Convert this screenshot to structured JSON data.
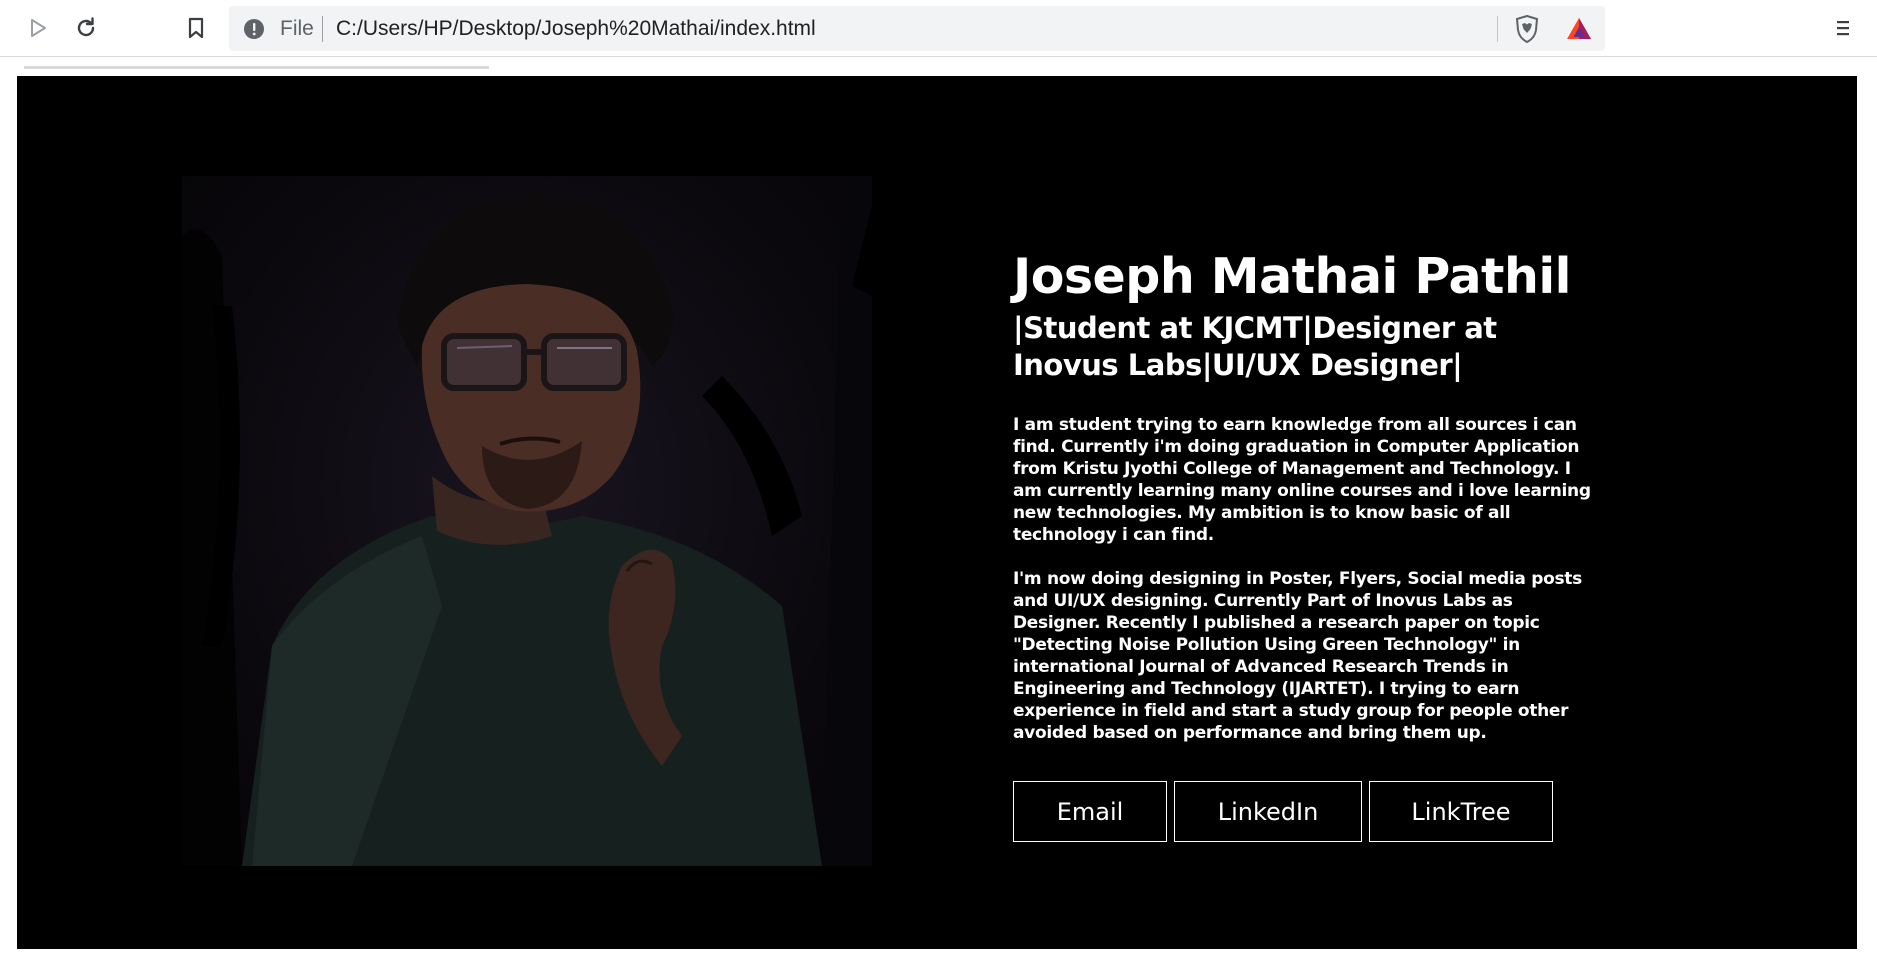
{
  "browser": {
    "url_scheme": "File",
    "url": "C:/Users/HP/Desktop/Joseph%20Mathai/index.html"
  },
  "profile": {
    "name": "Joseph Mathai Pathil",
    "tagline": "|Student at KJCMT|Designer at Inovus Labs|UI/UX Designer|",
    "paragraph_1": "I am student trying to earn knowledge from all sources i can find. Currently i'm doing graduation in Computer Application from Kristu Jyothi College of Management and Technology. I am currently learning many online courses and i love learning new technologies. My ambition is to know basic of all technology i can find.",
    "paragraph_2": "I'm now doing designing in Poster, Flyers, Social media posts and UI/UX designing. Currently Part of Inovus Labs as Designer. Recently I published a research paper on topic \"Detecting Noise Pollution Using Green Technology\" in international Journal of Advanced Research Trends in Engineering and Technology (IJARTET). I trying to earn experience in field and start a study group for people other avoided based on performance and bring them up."
  },
  "links": {
    "email_label": "Email",
    "linkedin_label": "LinkedIn",
    "linktree_label": "LinkTree"
  },
  "colors": {
    "page_background": "#000000",
    "text": "#ffffff",
    "brave_orange": "#fb542b",
    "bat_purple": "#662d91"
  },
  "icons": {
    "back": "play-icon",
    "reload": "reload-icon",
    "bookmark": "bookmark-icon",
    "info": "info-icon",
    "brave": "brave-shield-icon",
    "rewards": "bat-triangle-icon",
    "menu": "hamburger-menu-icon"
  }
}
